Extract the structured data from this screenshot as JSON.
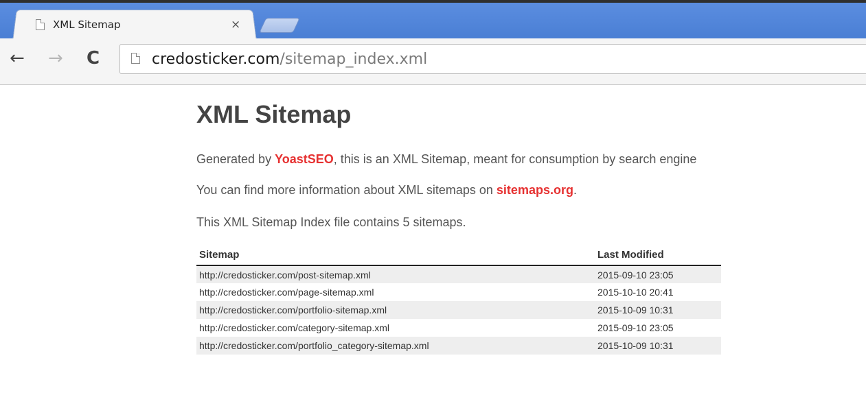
{
  "browser": {
    "tab": {
      "title": "XML Sitemap",
      "close_glyph": "×"
    },
    "nav": {
      "back_glyph": "←",
      "forward_glyph": "→",
      "reload_glyph": "C"
    },
    "url": {
      "host": "credosticker.com",
      "path": "/sitemap_index.xml"
    },
    "icons": {
      "page": "page-icon",
      "close": "close-icon",
      "back": "back-arrow-icon",
      "forward": "forward-arrow-icon",
      "reload": "reload-icon"
    },
    "colors": {
      "tabstrip": "#4a7fd4",
      "toolbar": "#f5f5f5"
    }
  },
  "page": {
    "title": "XML Sitemap",
    "intro": {
      "line1_prefix": "Generated by ",
      "line1_link": "YoastSEO",
      "line1_suffix": ", this is an XML Sitemap, meant for consumption by search engine",
      "line2_prefix": "You can find more information about XML sitemaps on ",
      "line2_link": "sitemaps.org",
      "line2_suffix": ".",
      "line3": "This XML Sitemap Index file contains 5 sitemaps."
    },
    "table": {
      "headers": {
        "sitemap": "Sitemap",
        "modified": "Last Modified"
      },
      "rows": [
        {
          "url": "http://credosticker.com/post-sitemap.xml",
          "modified": "2015-09-10 23:05"
        },
        {
          "url": "http://credosticker.com/page-sitemap.xml",
          "modified": "2015-10-10 20:41"
        },
        {
          "url": "http://credosticker.com/portfolio-sitemap.xml",
          "modified": "2015-10-09 10:31"
        },
        {
          "url": "http://credosticker.com/category-sitemap.xml",
          "modified": "2015-09-10 23:05"
        },
        {
          "url": "http://credosticker.com/portfolio_category-sitemap.xml",
          "modified": "2015-10-09 10:31"
        }
      ]
    },
    "colors": {
      "link": "#e63131",
      "title": "#444444",
      "row_stripe": "#eeeeee"
    }
  }
}
